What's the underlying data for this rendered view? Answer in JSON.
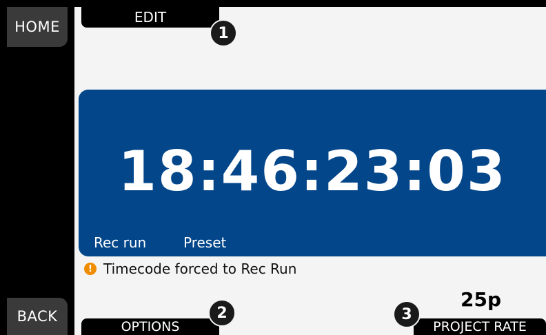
{
  "side": {
    "home_label": "HOME",
    "back_label": "BACK"
  },
  "tabs": {
    "edit_label": "EDIT",
    "options_label": "OPTIONS",
    "project_rate_label": "PROJECT RATE"
  },
  "badges": [
    "1",
    "2",
    "3"
  ],
  "timecode": {
    "value": "18:46:23:03",
    "mode_label": "Rec run",
    "preset_label": "Preset"
  },
  "warning": {
    "icon": "warning-icon",
    "text": "Timecode forced to Rec Run"
  },
  "project_rate": {
    "value": "25p"
  },
  "colors": {
    "panel": "#03468a",
    "warning": "#f08c00",
    "background": "#f4f4f4"
  }
}
